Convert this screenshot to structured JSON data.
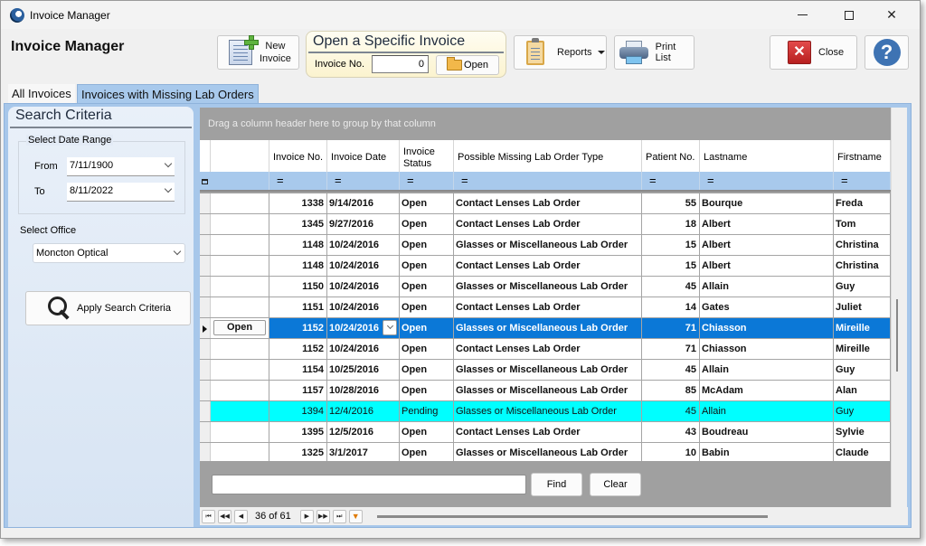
{
  "window": {
    "title": "Invoice Manager",
    "app_title": "Invoice Manager",
    "controls": {
      "minimize": "minimize",
      "maximize": "maximize",
      "close": "✕"
    }
  },
  "toolbar": {
    "new_invoice_line1": "New",
    "new_invoice_line2": "Invoice",
    "open_group_title": "Open a Specific Invoice",
    "invoice_no_label": "Invoice No.",
    "invoice_no_value": "0",
    "open_label": "Open",
    "reports_label": "Reports",
    "print_list_label": "Print List",
    "close_label": "Close",
    "help_glyph": "?"
  },
  "tabs": [
    {
      "label": "All Invoices",
      "active": false
    },
    {
      "label": "Invoices with Missing Lab Orders",
      "active": true
    }
  ],
  "search": {
    "title": "Search Criteria",
    "date_range_label": "Select Date Range",
    "from_label": "From",
    "from_value": "7/11/1900",
    "to_label": "To",
    "to_value": "8/11/2022",
    "office_label": "Select Office",
    "office_value": "Moncton Optical",
    "apply_label": "Apply Search Criteria"
  },
  "grid": {
    "group_hint": "Drag a column header here to group by that column",
    "columns": [
      "",
      "Invoice No.",
      "Invoice Date",
      "Invoice Status",
      "Possible Missing Lab Order Type",
      "Patient No.",
      "Lastname",
      "Firstname"
    ],
    "filter_symbol": "=",
    "row_action_label": "Open",
    "rows": [
      {
        "invoice_no": "1338",
        "date": "9/14/2016",
        "status": "Open",
        "type": "Contact Lenses Lab Order",
        "patient_no": "55",
        "lastname": "Bourque",
        "firstname": "Freda",
        "state": "normal"
      },
      {
        "invoice_no": "1345",
        "date": "9/27/2016",
        "status": "Open",
        "type": "Contact Lenses Lab Order",
        "patient_no": "18",
        "lastname": "Albert",
        "firstname": "Tom",
        "state": "normal"
      },
      {
        "invoice_no": "1148",
        "date": "10/24/2016",
        "status": "Open",
        "type": "Glasses or Miscellaneous Lab Order",
        "patient_no": "15",
        "lastname": "Albert",
        "firstname": "Christina",
        "state": "normal"
      },
      {
        "invoice_no": "1148",
        "date": "10/24/2016",
        "status": "Open",
        "type": "Contact Lenses Lab Order",
        "patient_no": "15",
        "lastname": "Albert",
        "firstname": "Christina",
        "state": "normal"
      },
      {
        "invoice_no": "1150",
        "date": "10/24/2016",
        "status": "Open",
        "type": "Glasses or Miscellaneous Lab Order",
        "patient_no": "45",
        "lastname": "Allain",
        "firstname": "Guy",
        "state": "normal"
      },
      {
        "invoice_no": "1151",
        "date": "10/24/2016",
        "status": "Open",
        "type": "Contact Lenses Lab Order",
        "patient_no": "14",
        "lastname": "Gates",
        "firstname": "Juliet",
        "state": "normal"
      },
      {
        "invoice_no": "1152",
        "date": "10/24/2016",
        "status": "Open",
        "type": "Glasses or Miscellaneous Lab Order",
        "patient_no": "71",
        "lastname": "Chiasson",
        "firstname": "Mireille",
        "state": "selected"
      },
      {
        "invoice_no": "1152",
        "date": "10/24/2016",
        "status": "Open",
        "type": "Contact Lenses Lab Order",
        "patient_no": "71",
        "lastname": "Chiasson",
        "firstname": "Mireille",
        "state": "normal"
      },
      {
        "invoice_no": "1154",
        "date": "10/25/2016",
        "status": "Open",
        "type": "Glasses or Miscellaneous Lab Order",
        "patient_no": "45",
        "lastname": "Allain",
        "firstname": "Guy",
        "state": "normal"
      },
      {
        "invoice_no": "1157",
        "date": "10/28/2016",
        "status": "Open",
        "type": "Glasses or Miscellaneous Lab Order",
        "patient_no": "85",
        "lastname": "McAdam",
        "firstname": "Alan",
        "state": "normal"
      },
      {
        "invoice_no": "1394",
        "date": "12/4/2016",
        "status": "Pending",
        "type": "Glasses or Miscellaneous Lab Order",
        "patient_no": "45",
        "lastname": "Allain",
        "firstname": "Guy",
        "state": "pending"
      },
      {
        "invoice_no": "1395",
        "date": "12/5/2016",
        "status": "Open",
        "type": "Contact Lenses Lab Order",
        "patient_no": "43",
        "lastname": "Boudreau",
        "firstname": "Sylvie",
        "state": "normal"
      },
      {
        "invoice_no": "1325",
        "date": "3/1/2017",
        "status": "Open",
        "type": "Glasses or Miscellaneous Lab Order",
        "patient_no": "10",
        "lastname": "Babin",
        "firstname": "Claude",
        "state": "normal"
      }
    ],
    "find_value": "",
    "find_label": "Find",
    "clear_label": "Clear"
  },
  "navigator": {
    "position": "36 of 61",
    "first": "⏮",
    "prev_page": "◀◀",
    "prev": "◀",
    "next": "▶",
    "next_page": "▶▶",
    "last": "⏭",
    "filter": "▼"
  },
  "colors": {
    "selected_row": "#0b78d7",
    "pending_row": "#00ffff",
    "tab_active": "#a8c9ec"
  }
}
